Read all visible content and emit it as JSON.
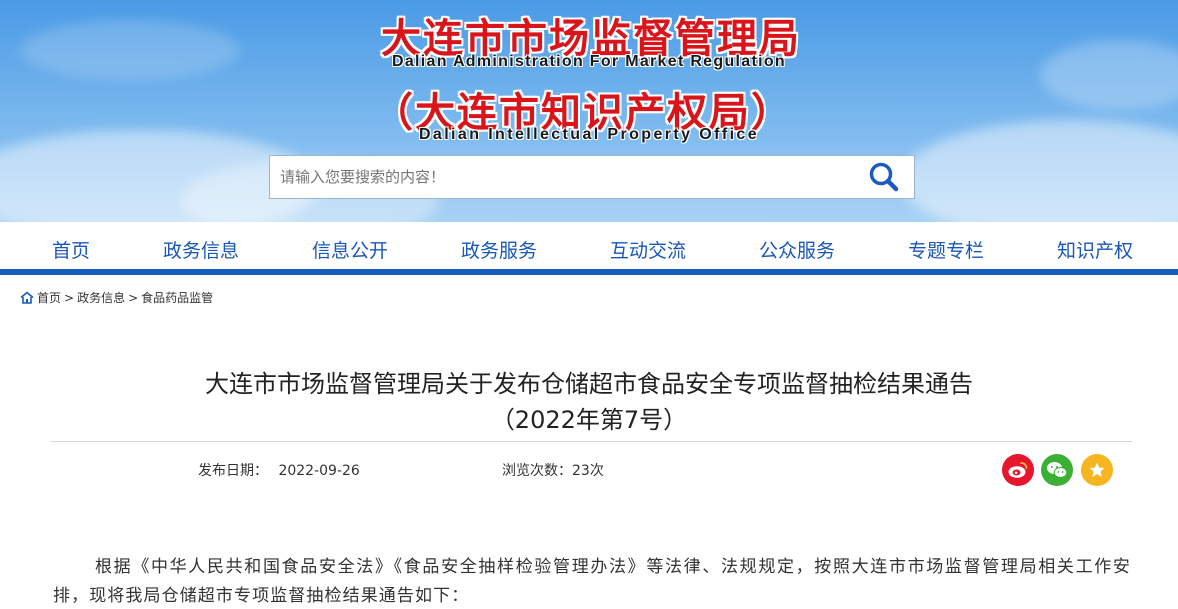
{
  "header": {
    "title_cn": "大连市市场监督管理局",
    "title_en": "Dalian Administration For Market Regulation",
    "subtitle_cn": "（大连市知识产权局）",
    "subtitle_en": "Dalian Intellectual Property Office"
  },
  "search": {
    "placeholder": "请输入您要搜索的内容！",
    "icon": "search-icon"
  },
  "nav": {
    "items": [
      "首页",
      "政务信息",
      "信息公开",
      "政务服务",
      "互动交流",
      "公众服务",
      "专题专栏",
      "知识产权"
    ]
  },
  "breadcrumb": {
    "home": "首页",
    "level1": "政务信息",
    "level2": "食品药品监管",
    "separator": ">"
  },
  "article": {
    "title_line1": "大连市市场监督管理局关于发布仓储超市食品安全专项监督抽检结果通告",
    "title_line2": "（2022年第7号）",
    "publish_label": "发布日期：",
    "publish_date": "2022-09-26",
    "views_label": "浏览次数：",
    "views": "23次",
    "body": "根据《中华人民共和国食品安全法》《食品安全抽样检验管理办法》等法律、法规规定，按照大连市市场监督管理局相关工作安排，现将我局仓储超市专项监督抽检结果通告如下："
  },
  "share": {
    "weibo_color": "#e6162d",
    "wechat_color": "#3cb034",
    "favorite_color": "#f5b622"
  },
  "colors": {
    "title_red": "#d9141b",
    "nav_blue": "#1957b8",
    "bar_blue": "#1a5cbd"
  }
}
